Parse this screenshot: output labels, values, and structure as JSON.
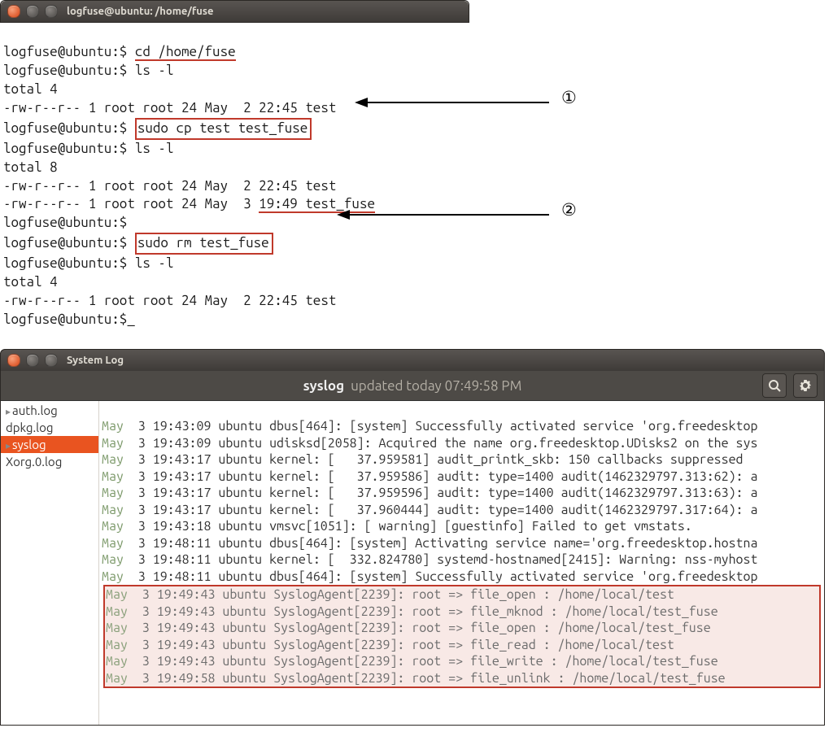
{
  "terminal": {
    "title": "logfuse@ubuntu: /home/fuse",
    "prompt": "logfuse@ubuntu:$",
    "cmd_cd": "cd /home/fuse",
    "cmd_ls1": "ls -l",
    "total4": "total 4",
    "file_test1": "-rw-r--r-- 1 root root 24 May  2 22:45 test",
    "cmd_cp": "sudo cp test test_fuse",
    "cmd_ls2": "ls -l",
    "total8": "total 8",
    "file_test2": "-rw-r--r-- 1 root root 24 May  2 22:45 test",
    "file_testfuse_pre": "-rw-r--r-- 1 root root 24 May  3 ",
    "file_testfuse_time": "19:49",
    "file_testfuse_name": " test_fuse",
    "cmd_rm": "sudo rm test_fuse",
    "cmd_ls3": "ls -l",
    "total4b": "total 4",
    "file_test3": "-rw-r--r-- 1 root root 24 May  2 22:45 test"
  },
  "callouts": {
    "one": "①",
    "two": "②"
  },
  "syslog": {
    "title": "System Log",
    "subbar_name": "syslog",
    "subbar_updated": "updated today 07:49:58 PM",
    "sidebar": {
      "items": [
        {
          "label": "auth.log",
          "selected": false,
          "expandable": true
        },
        {
          "label": "dpkg.log",
          "selected": false,
          "expandable": false
        },
        {
          "label": "syslog",
          "selected": true,
          "expandable": true
        },
        {
          "label": "Xorg.0.log",
          "selected": false,
          "expandable": false
        }
      ]
    },
    "lines": [
      {
        "ts": "May  3 19:43:09",
        "msg": "ubuntu dbus[464]: [system] Successfully activated service 'org.freedesktop"
      },
      {
        "ts": "May  3 19:43:09",
        "msg": "ubuntu udisksd[2058]: Acquired the name org.freedesktop.UDisks2 on the sys"
      },
      {
        "ts": "May  3 19:43:17",
        "msg": "ubuntu kernel: [   37.959581] audit_printk_skb: 150 callbacks suppressed"
      },
      {
        "ts": "May  3 19:43:17",
        "msg": "ubuntu kernel: [   37.959586] audit: type=1400 audit(1462329797.313:62): a"
      },
      {
        "ts": "May  3 19:43:17",
        "msg": "ubuntu kernel: [   37.959596] audit: type=1400 audit(1462329797.313:63): a"
      },
      {
        "ts": "May  3 19:43:17",
        "msg": "ubuntu kernel: [   37.960444] audit: type=1400 audit(1462329797.317:64): a"
      },
      {
        "ts": "May  3 19:43:18",
        "msg": "ubuntu vmsvc[1051]: [ warning] [guestinfo] Failed to get vmstats."
      },
      {
        "ts": "May  3 19:48:11",
        "msg": "ubuntu dbus[464]: [system] Activating service name='org.freedesktop.hostna"
      },
      {
        "ts": "May  3 19:48:11",
        "msg": "ubuntu kernel: [  332.824780] systemd-hostnamed[2415]: Warning: nss-myhost"
      },
      {
        "ts": "May  3 19:48:11",
        "msg": "ubuntu dbus[464]: [system] Successfully activated service 'org.freedesktop"
      }
    ],
    "highlighted_lines": [
      {
        "ts": "May  3 19:49:43",
        "msg": "ubuntu SyslogAgent[2239]: root => file_open : /home/local/test"
      },
      {
        "ts": "May  3 19:49:43",
        "msg": "ubuntu SyslogAgent[2239]: root => file_mknod : /home/local/test_fuse"
      },
      {
        "ts": "May  3 19:49:43",
        "msg": "ubuntu SyslogAgent[2239]: root => file_open : /home/local/test_fuse"
      },
      {
        "ts": "May  3 19:49:43",
        "msg": "ubuntu SyslogAgent[2239]: root => file_read : /home/local/test"
      },
      {
        "ts": "May  3 19:49:43",
        "msg": "ubuntu SyslogAgent[2239]: root => file_write : /home/local/test_fuse"
      },
      {
        "ts": "May  3 19:49:58",
        "msg": "ubuntu SyslogAgent[2239]: root => file_unlink : /home/local/test_fuse"
      }
    ]
  }
}
